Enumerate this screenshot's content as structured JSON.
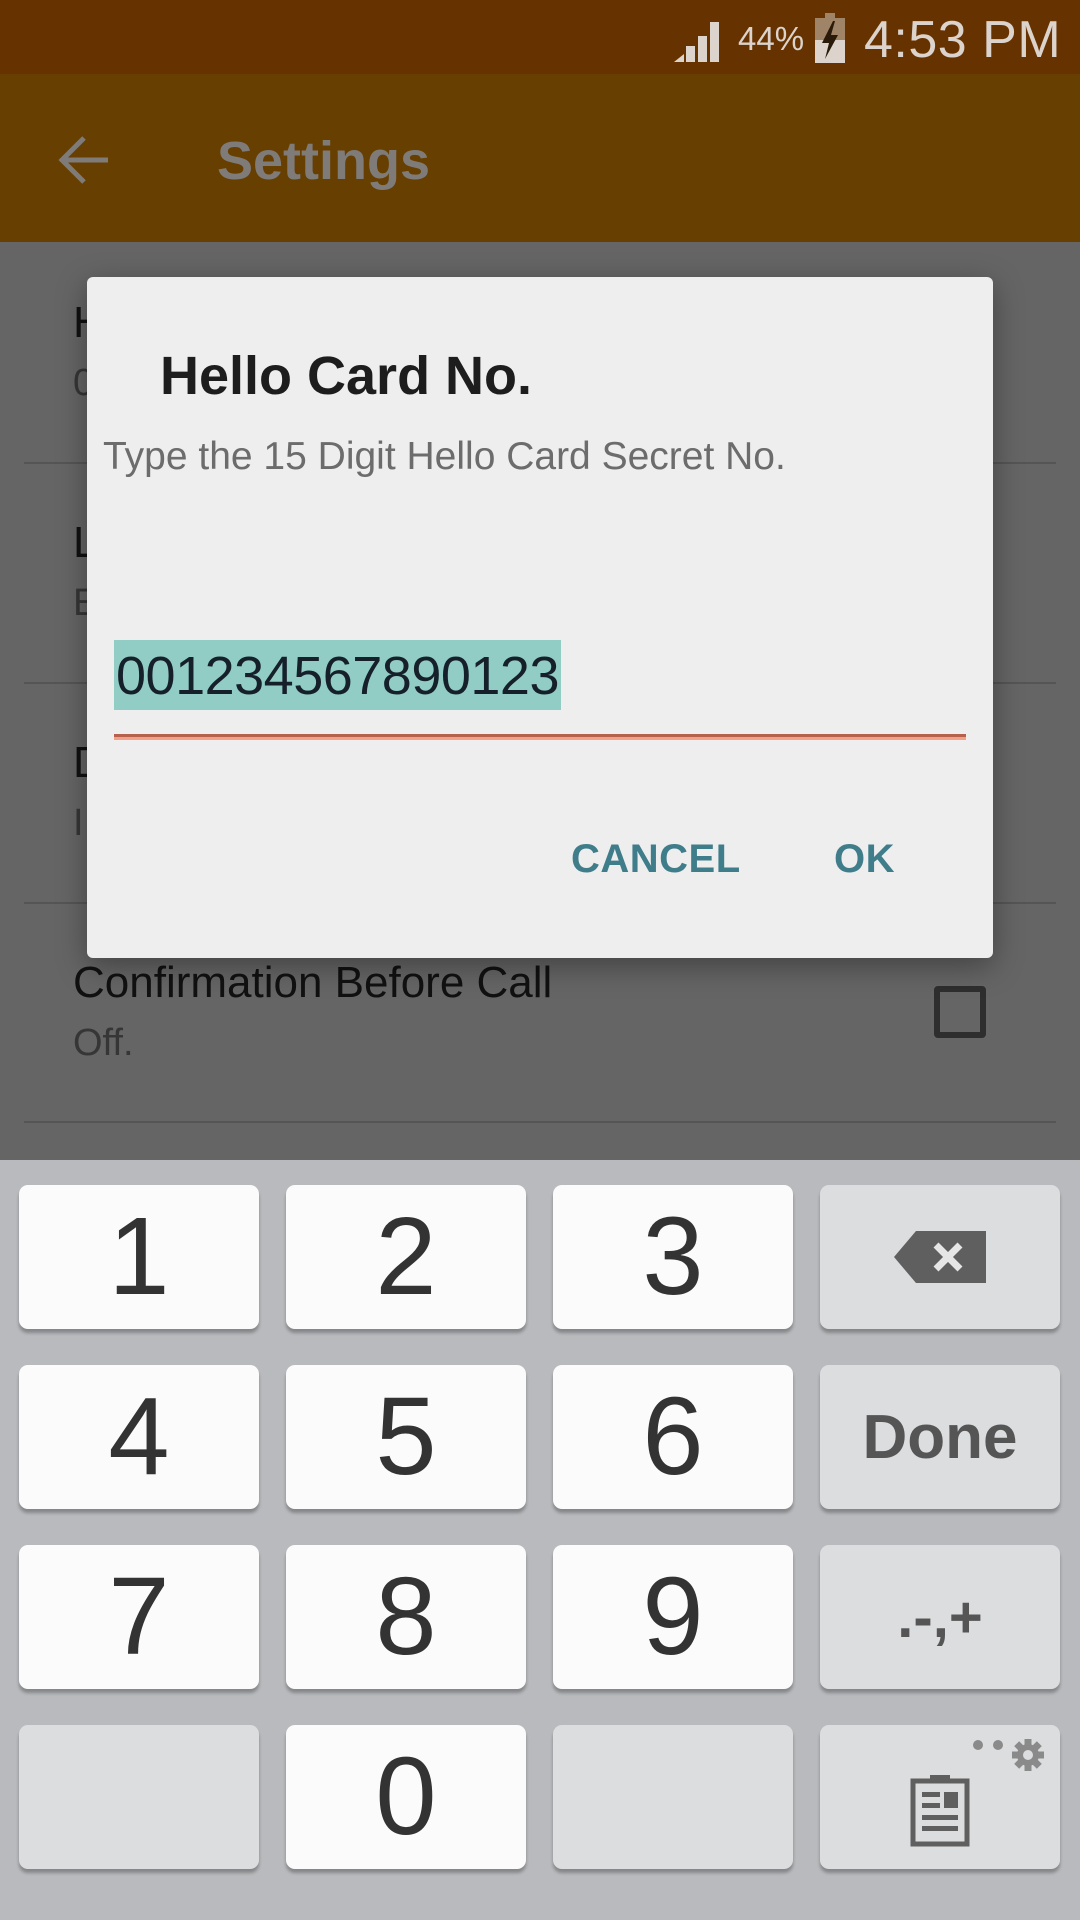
{
  "status_bar": {
    "signal_icon": "cell-signal-icon",
    "battery_percent": "44%",
    "battery_icon": "battery-charging-icon",
    "time": "4:53 PM"
  },
  "app_bar": {
    "back_icon": "arrow-back-icon",
    "title": "Settings"
  },
  "settings": {
    "items": [
      {
        "title": "H",
        "summary": "0"
      },
      {
        "title": "L",
        "summary": "E"
      },
      {
        "title": "D",
        "summary": "I"
      },
      {
        "title": "Confirmation Before Call",
        "summary": "Off.",
        "checked": false
      }
    ]
  },
  "dialog": {
    "title": "Hello Card No.",
    "message": "Type the 15 Digit Hello Card Secret No.",
    "input_value": "001234567890123",
    "cancel_label": "CANCEL",
    "ok_label": "OK"
  },
  "keyboard": {
    "keys": [
      "1",
      "2",
      "3",
      "4",
      "5",
      "6",
      "7",
      "8",
      "9",
      "0"
    ],
    "backspace_icon": "backspace-icon",
    "done_label": "Done",
    "symbols_label": ".-,+",
    "clipboard_icon": "clipboard-icon",
    "settings_icon": "gear-icon"
  },
  "colors": {
    "status_bar": "#663300",
    "app_bar_dimmed": "#673f00",
    "selection": "#91cdc4",
    "underline": "#f4a088",
    "dialog_button": "#3f7d8b",
    "keyboard_bg": "#b8babd"
  }
}
